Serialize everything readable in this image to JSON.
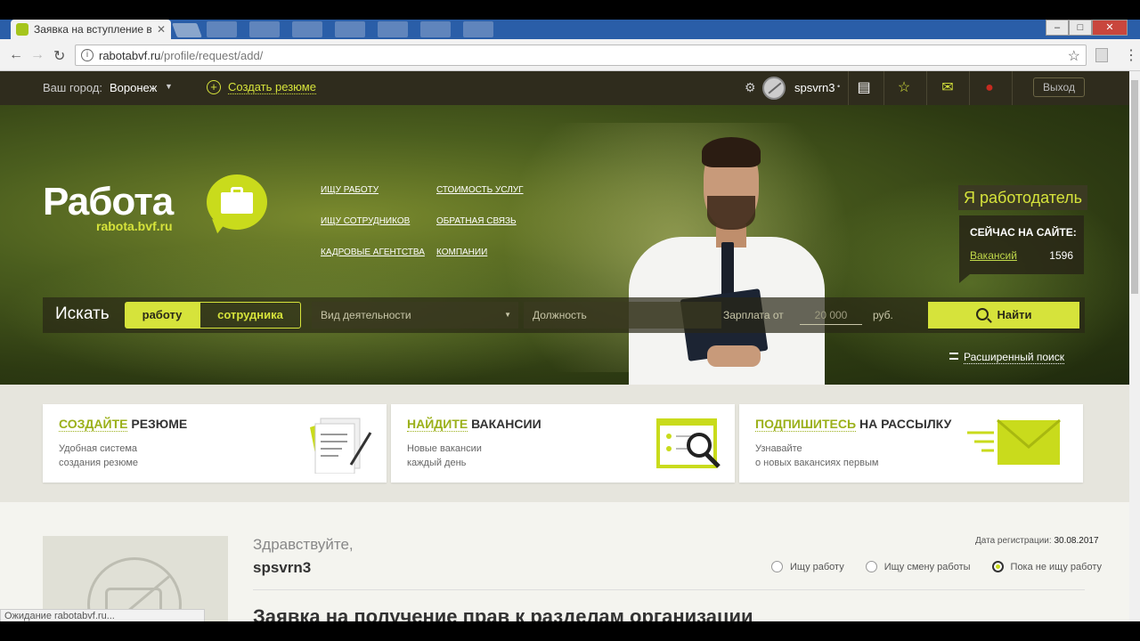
{
  "browser": {
    "tab_title": "Заявка на вступление в",
    "url_domain": "rabotabvf.ru",
    "url_path": "/profile/request/add/",
    "status_text": "Ожидание rabotabvf.ru..."
  },
  "topnav": {
    "city_label": "Ваш город:",
    "city": "Воронеж",
    "create_resume": "Создать резюме",
    "username": "spsvrn3",
    "logout": "Выход",
    "icons": [
      "gear-icon",
      "document-icon",
      "star-icon",
      "chat-icon",
      "notification-icon"
    ]
  },
  "hero": {
    "logo_word": "Работа",
    "logo_sub": "rabota.bvf.ru",
    "menu": {
      "col1": [
        "ИЩУ РАБОТУ",
        "ИЩУ СОТРУДНИКОВ",
        "КАДРОВЫЕ АГЕНТСТВА"
      ],
      "col2": [
        "СТОИМОСТЬ УСЛУГ",
        "ОБРАТНАЯ СВЯЗЬ",
        "КОМПАНИИ"
      ]
    },
    "employer_label": "Я работодатель",
    "onsite_title": "СЕЙЧАС НА САЙТЕ:",
    "vacancies_label": "Вакансий",
    "vacancies_count": "1596"
  },
  "search": {
    "label": "Искать",
    "toggle_work": "работу",
    "toggle_employee": "сотрудника",
    "activity_placeholder": "Вид деятельности",
    "position_placeholder": "Должность",
    "salary_label": "Зарплата от",
    "salary_value": "20 000",
    "currency": "руб.",
    "find_button": "Найти",
    "advanced": "Расширенный поиск"
  },
  "cards": [
    {
      "highlight": "СОЗДАЙТЕ",
      "rest": " РЕЗЮМЕ",
      "desc1": "Удобная система",
      "desc2": "создания резюме",
      "icon": "document-pen-icon"
    },
    {
      "highlight": "НАЙДИТЕ",
      "rest": " ВАКАНСИИ",
      "desc1": "Новые вакансии",
      "desc2": "каждый день",
      "icon": "folder-magnifier-icon"
    },
    {
      "highlight": "ПОДПИШИТЕСЬ",
      "rest": " НА РАССЫЛКУ",
      "desc1": "Узнавайте",
      "desc2": "о новых вакансиях первым",
      "icon": "envelope-icon"
    }
  ],
  "profile": {
    "greeting": "Здравствуйте,",
    "name": "spsvrn3",
    "reg_label": "Дата регистрации:",
    "reg_date": "30.08.2017",
    "status_options": [
      "Ищу работу",
      "Ищу смену работы",
      "Пока не ищу работу"
    ],
    "status_selected": 2,
    "request_title": "Заявка на получение прав к разделам организации"
  },
  "colors": {
    "accent": "#d6e33b",
    "nav_bg": "#2f2c1d",
    "card_highlight": "#9bb01a"
  }
}
